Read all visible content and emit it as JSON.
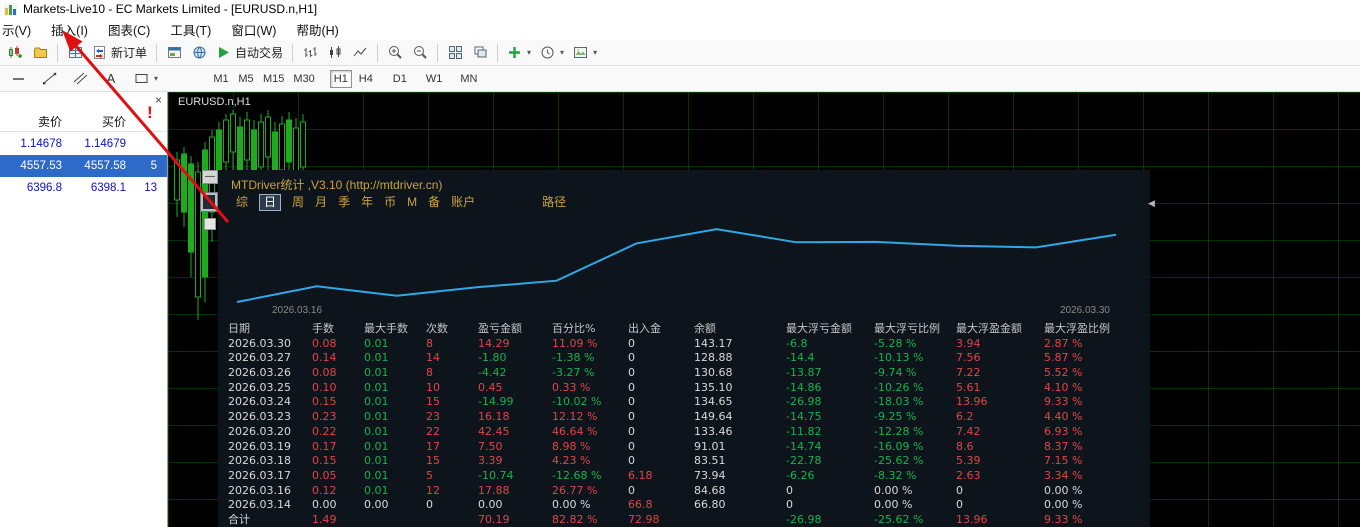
{
  "title_bar": {
    "app_title": "Markets-Live10 - EC Markets Limited - [EURUSD.n,H1]"
  },
  "menu": {
    "items": [
      "示(V)",
      "插入(I)",
      "图表(C)",
      "工具(T)",
      "窗口(W)",
      "帮助(H)"
    ]
  },
  "toolbar": {
    "new_order_label": "新订单",
    "autotrading_label": "自动交易"
  },
  "timeframes": {
    "items": [
      "M1",
      "M5",
      "M15",
      "M30",
      "H1",
      "H4",
      "D1",
      "W1",
      "MN"
    ],
    "active": "H1"
  },
  "market_watch": {
    "headers": {
      "sell": "卖价",
      "buy": "买价"
    },
    "rows": [
      {
        "sell": "1.14678",
        "buy": "1.14679",
        "extra": "",
        "selected": false
      },
      {
        "sell": "4557.53",
        "buy": "4557.58",
        "extra": "5",
        "selected": true
      },
      {
        "sell": "6396.8",
        "buy": "6398.1",
        "extra": "13",
        "selected": false
      }
    ]
  },
  "chart": {
    "symbol_label": "EURUSD.n,H1"
  },
  "panel": {
    "title": "MTDriver统计 ,V3.10 (http://mtdriver.cn)",
    "tabs": [
      "综",
      "日",
      "周",
      "月",
      "季",
      "年",
      "币",
      "M",
      "备",
      "账户"
    ],
    "active_tab": "日",
    "path_tab": "路径",
    "axis_start": "2026.03.16",
    "axis_end": "2026.03.30"
  },
  "chart_data": {
    "type": "line",
    "title": "",
    "xlabel": "",
    "ylabel": "",
    "x": [
      "2026.03.14",
      "2026.03.16",
      "2026.03.17",
      "2026.03.18",
      "2026.03.19",
      "2026.03.20",
      "2026.03.23",
      "2026.03.24",
      "2026.03.25",
      "2026.03.26",
      "2026.03.27",
      "2026.03.30"
    ],
    "series": [
      {
        "name": "余额",
        "values": [
          66.8,
          84.68,
          73.94,
          83.51,
          91.01,
          133.46,
          149.64,
          134.65,
          135.1,
          130.68,
          128.88,
          143.17
        ]
      }
    ],
    "visible_x_labels": [
      "2026.03.16",
      "2026.03.30"
    ],
    "ylim": [
      60,
      160
    ],
    "grid": false,
    "legend": false,
    "line_color": "#2fa8e8"
  },
  "table": {
    "headers": [
      "日期",
      "手数",
      "最大手数",
      "次数",
      "盈亏金额",
      "百分比%",
      "出入金",
      "余额",
      "最大浮亏金额",
      "最大浮亏比例",
      "最大浮盈金额",
      "最大浮盈比例"
    ],
    "col_styles": [
      "plain",
      "sign",
      "green",
      "sign",
      "sign",
      "sign",
      "sign",
      "plain",
      "sign",
      "sign",
      "sign",
      "sign"
    ],
    "rows": [
      [
        "2026.03.30",
        "0.08",
        "0.01",
        "8",
        "14.29",
        "11.09 %",
        "0",
        "143.17",
        "-6.8",
        "-5.28 %",
        "3.94",
        "2.87 %"
      ],
      [
        "2026.03.27",
        "0.14",
        "0.01",
        "14",
        "-1.80",
        "-1.38 %",
        "0",
        "128.88",
        "-14.4",
        "-10.13 %",
        "7.56",
        "5.87 %"
      ],
      [
        "2026.03.26",
        "0.08",
        "0.01",
        "8",
        "-4.42",
        "-3.27 %",
        "0",
        "130.68",
        "-13.87",
        "-9.74 %",
        "7.22",
        "5.52 %"
      ],
      [
        "2026.03.25",
        "0.10",
        "0.01",
        "10",
        "0.45",
        "0.33 %",
        "0",
        "135.10",
        "-14.86",
        "-10.26 %",
        "5.61",
        "4.10 %"
      ],
      [
        "2026.03.24",
        "0.15",
        "0.01",
        "15",
        "-14.99",
        "-10.02 %",
        "0",
        "134.65",
        "-26.98",
        "-18.03 %",
        "13.96",
        "9.33 %"
      ],
      [
        "2026.03.23",
        "0.23",
        "0.01",
        "23",
        "16.18",
        "12.12 %",
        "0",
        "149.64",
        "-14.75",
        "-9.25 %",
        "6.2",
        "4.40 %"
      ],
      [
        "2026.03.20",
        "0.22",
        "0.01",
        "22",
        "42.45",
        "46.64 %",
        "0",
        "133.46",
        "-11.82",
        "-12.28 %",
        "7.42",
        "6.93 %"
      ],
      [
        "2026.03.19",
        "0.17",
        "0.01",
        "17",
        "7.50",
        "8.98 %",
        "0",
        "91.01",
        "-14.74",
        "-16.09 %",
        "8.6",
        "8.37 %"
      ],
      [
        "2026.03.18",
        "0.15",
        "0.01",
        "15",
        "3.39",
        "4.23 %",
        "0",
        "83.51",
        "-22.78",
        "-25.62 %",
        "5.39",
        "7.15 %"
      ],
      [
        "2026.03.17",
        "0.05",
        "0.01",
        "5",
        "-10.74",
        "-12.68 %",
        "6.18",
        "73.94",
        "-6.26",
        "-8.32 %",
        "2.63",
        "3.34 %"
      ],
      [
        "2026.03.16",
        "0.12",
        "0.01",
        "12",
        "17.88",
        "26.77 %",
        "0",
        "84.68",
        "0",
        "0.00 %",
        "0",
        "0.00 %"
      ],
      [
        "2026.03.14",
        "0.00",
        "0.00",
        "0",
        "0.00",
        "0.00 %",
        "66.8",
        "66.80",
        "0",
        "0.00 %",
        "0",
        "0.00 %"
      ]
    ],
    "total": [
      "合计",
      "1.49",
      "",
      "",
      "70.19",
      "82.82 %",
      "72.98",
      "",
      "-26.98",
      "-25.62 %",
      "13.96",
      "9.33 %"
    ]
  },
  "candles": [
    [
      9,
      60,
      125,
      68,
      108,
      1
    ],
    [
      16,
      55,
      135,
      62,
      120,
      0
    ],
    [
      23,
      64,
      185,
      72,
      160,
      0
    ],
    [
      30,
      70,
      228,
      80,
      205,
      1
    ],
    [
      37,
      50,
      210,
      58,
      185,
      0
    ],
    [
      44,
      38,
      150,
      45,
      120,
      1
    ],
    [
      51,
      30,
      105,
      38,
      85,
      0
    ],
    [
      58,
      22,
      90,
      28,
      70,
      1
    ],
    [
      65,
      18,
      80,
      22,
      60,
      1
    ],
    [
      72,
      25,
      100,
      35,
      80,
      0
    ],
    [
      79,
      20,
      85,
      28,
      68,
      1
    ],
    [
      86,
      28,
      110,
      38,
      90,
      0
    ],
    [
      93,
      22,
      95,
      30,
      75,
      1
    ],
    [
      100,
      18,
      88,
      25,
      65,
      1
    ],
    [
      107,
      30,
      105,
      40,
      82,
      0
    ],
    [
      114,
      24,
      98,
      32,
      78,
      1
    ],
    [
      121,
      20,
      92,
      28,
      70,
      0
    ],
    [
      128,
      26,
      102,
      36,
      84,
      1
    ],
    [
      135,
      22,
      96,
      30,
      75,
      1
    ]
  ],
  "icons": {
    "close": "×",
    "minimize": "—",
    "collapse_left": "◀",
    "dropdown": "▾"
  },
  "annotation": {
    "exclamation": "!"
  },
  "colors": {
    "red": "#e04545",
    "green": "#16b24b",
    "neutral": "#d8d8d8",
    "gold": "#c9a33c",
    "equity_line": "#2fa8e8",
    "candle": "#20aa20",
    "selected_row_bg": "#2e6ac8",
    "price_blue": "#0a10c8",
    "annotation_red": "#e01010"
  }
}
